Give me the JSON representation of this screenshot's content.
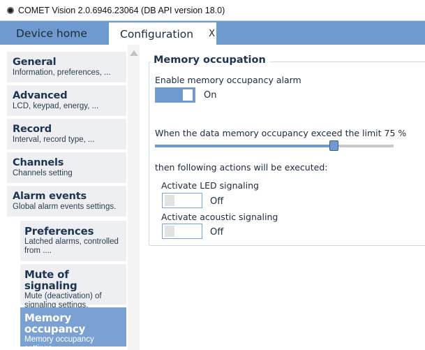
{
  "window": {
    "title": "COMET Vision 2.0.6946.23064 (DB API version 18.0)"
  },
  "tabs": {
    "home_label": "Device home",
    "config_label": "Configuration",
    "close_glyph": "X"
  },
  "sidebar": {
    "items": [
      {
        "title": "General",
        "desc": "Information, preferences, ..."
      },
      {
        "title": "Advanced",
        "desc": "LCD, keypad, energy, ..."
      },
      {
        "title": "Record",
        "desc": "Interval, record type, ..."
      },
      {
        "title": "Channels",
        "desc": "Channels setting"
      },
      {
        "title": "Alarm events",
        "desc": "Global alarm events settings."
      }
    ],
    "subitems": [
      {
        "title": "Preferences",
        "desc": "Latched alarms, controlled from ...."
      },
      {
        "title": "Mute of signaling",
        "desc": "Mute (deactivation) of signaling settings."
      },
      {
        "title": "Memory occupancy",
        "desc": "Memory occupancy settings."
      }
    ]
  },
  "content": {
    "group_title": "Memory occupation",
    "enable_label": "Enable memory occupancy alarm",
    "enable_state": "On",
    "limit_label": "When the data memory occupancy exceed the limit 75 %",
    "limit_value": 75,
    "actions_label": "then following actions will be executed:",
    "led_label": "Activate LED signaling",
    "led_state": "Off",
    "acoustic_label": "Activate acoustic signaling",
    "acoustic_state": "Off"
  },
  "colors": {
    "accent": "#6f9ad0",
    "active_nav": "#7ba1d3",
    "nav_bg": "#edeff2"
  }
}
